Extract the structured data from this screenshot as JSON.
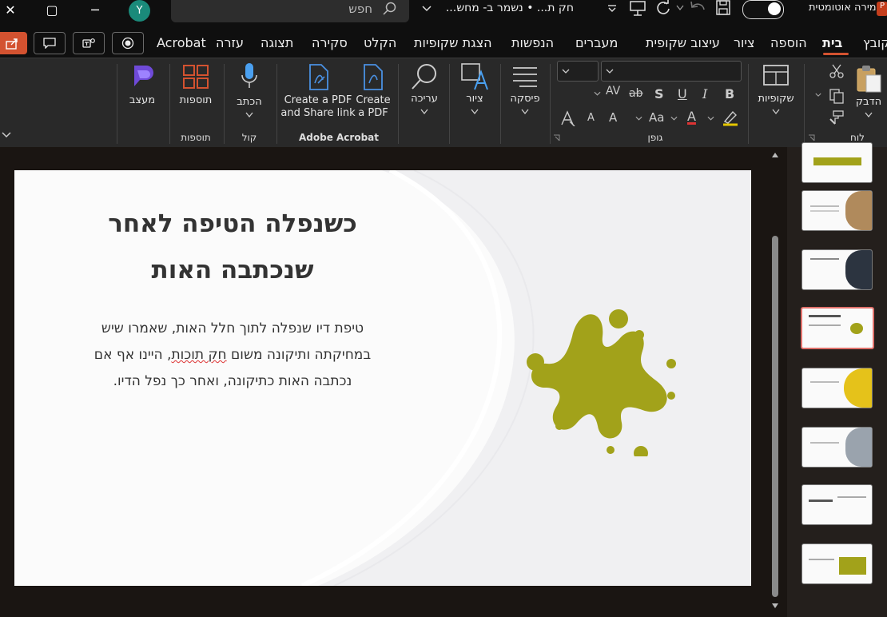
{
  "titlebar": {
    "close_glyph": "✕",
    "restore_glyph": "▢",
    "minimize_glyph": "─",
    "avatar_initial": "Y",
    "search_placeholder": "חפש",
    "doc_title": "חק ת... • נשמר ב- מחש...",
    "autosave_label": "שמירה אוטומטית",
    "ppt_letter": "P"
  },
  "menu": {
    "items": [
      "קובץ",
      "בית",
      "הוספה",
      "ציור",
      "עיצוב שקופית",
      "מעברים",
      "הנפשות",
      "הצגת שקופיות",
      "הקלט",
      "סקירה",
      "תצוגה",
      "עזרה",
      "Acrobat"
    ],
    "active": "בית"
  },
  "ribbon": {
    "designer_label": "מעצב",
    "addins_label": "תוספות",
    "addins_group": "תוספות",
    "dictate_label": "הכתב",
    "voice_group": "קול",
    "create_share_label_1": "Create a PDF",
    "create_share_label_2": "and Share link",
    "create_pdf_label_1": "Create",
    "create_pdf_label_2": "a PDF",
    "acrobat_group": "Adobe Acrobat",
    "editing_label": "עריכה",
    "draw_label": "ציור",
    "paragraph_label": "פיסקה",
    "font_group": "גופן",
    "slides_label": "שקופיות",
    "paste_label": "הדבק",
    "clipboard_group": "לוח",
    "bold": "B",
    "italic": "I",
    "underline": "U",
    "shadow": "S",
    "strike": "ab",
    "char_spacing": "AV",
    "grow_font": "A",
    "shrink_font": "A",
    "change_case": "Aa",
    "font_color": "A"
  },
  "slide": {
    "title_line1": "כשנפלה הטיפה לאחר",
    "title_line2": "שנכתבה האות",
    "body_part1": "טיפת דיו שנפלה לתוך חלל האות, שאמרו שיש במחיקתה ותיקונה משום ",
    "body_squiggle": "חק תוכות",
    "body_part2": ", היינו אף אם נכתבה האות כתיקונה, ואחר כך נפל הדיו.",
    "splat_color": "#a2a21a"
  },
  "colors": {
    "accent": "#d35230",
    "selection": "#e0706a"
  }
}
